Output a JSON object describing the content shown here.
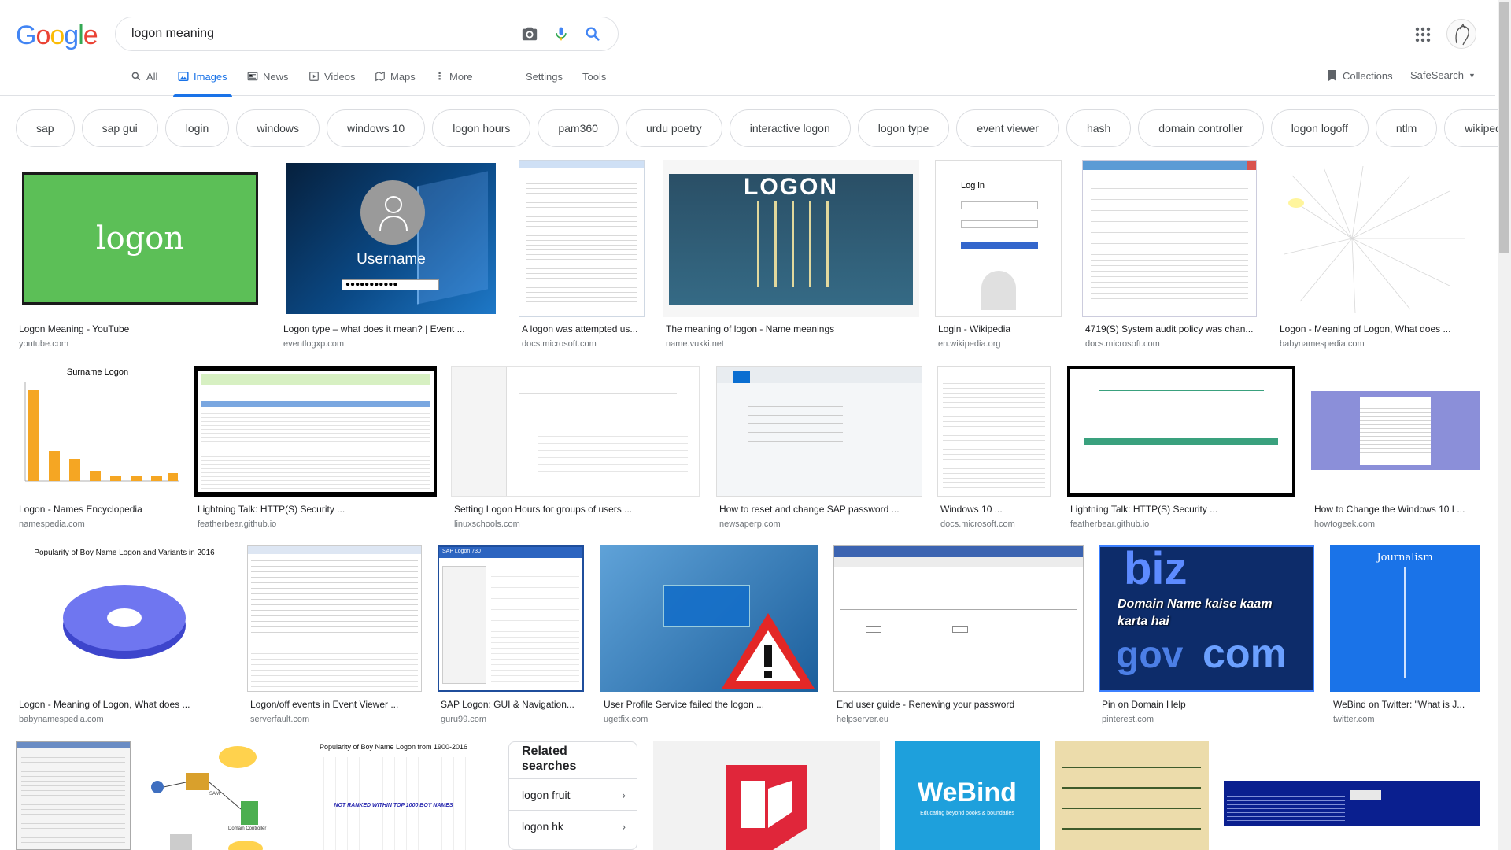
{
  "search": {
    "query": "logon meaning"
  },
  "logo": {
    "letters": [
      "G",
      "o",
      "o",
      "g",
      "l",
      "e"
    ],
    "colors": [
      "#4285F4",
      "#EA4335",
      "#FBBC05",
      "#4285F4",
      "#34A853",
      "#EA4335"
    ]
  },
  "tabs": [
    {
      "label": "All",
      "icon": "search-icon"
    },
    {
      "label": "Images",
      "icon": "image-icon",
      "active": true
    },
    {
      "label": "News",
      "icon": "news-icon"
    },
    {
      "label": "Videos",
      "icon": "video-icon"
    },
    {
      "label": "Maps",
      "icon": "map-icon"
    },
    {
      "label": "More",
      "icon": "more-vert-icon"
    }
  ],
  "tools": {
    "settings": "Settings",
    "tools": "Tools",
    "collections": "Collections",
    "safesearch": "SafeSearch"
  },
  "chips": [
    "sap",
    "sap gui",
    "login",
    "windows",
    "windows 10",
    "logon hours",
    "pam360",
    "urdu poetry",
    "interactive logon",
    "logon type",
    "event viewer",
    "hash",
    "domain controller",
    "logon logoff",
    "ntlm",
    "wikipedia"
  ],
  "results_row1": [
    {
      "caption": "Logon Meaning - YouTube",
      "source": "youtube.com",
      "overlay": "logon"
    },
    {
      "caption": "Logon type – what does it mean? | Event ...",
      "source": "eventlogxp.com",
      "overlay": "Username"
    },
    {
      "caption": "A logon was attempted us...",
      "source": "docs.microsoft.com"
    },
    {
      "caption": "The meaning of logon - Name meanings",
      "source": "name.vukki.net",
      "overlay": "LOGON"
    },
    {
      "caption": "Login - Wikipedia",
      "source": "en.wikipedia.org",
      "overlay": "Log in"
    },
    {
      "caption": "4719(S) System audit policy was chan...",
      "source": "docs.microsoft.com"
    },
    {
      "caption": "Logon - Meaning of Logon, What does ...",
      "source": "babynamespedia.com"
    }
  ],
  "results_row2": [
    {
      "caption": "Logon - Names Encyclopedia",
      "source": "namespedia.com",
      "overlay": "Surname Logon"
    },
    {
      "caption": "Lightning Talk: HTTP(S) Security ...",
      "source": "featherbear.github.io"
    },
    {
      "caption": "Setting Logon Hours for groups of users ...",
      "source": "linuxschools.com"
    },
    {
      "caption": "How to reset and change SAP password ...",
      "source": "newsaperp.com"
    },
    {
      "caption": "Windows 10 ...",
      "source": "docs.microsoft.com"
    },
    {
      "caption": "Lightning Talk: HTTP(S) Security ...",
      "source": "featherbear.github.io"
    },
    {
      "caption": "How to Change the Windows 10 L...",
      "source": "howtogeek.com"
    }
  ],
  "results_row3": [
    {
      "caption": "Logon - Meaning of Logon, What does ...",
      "source": "babynamespedia.com",
      "overlay": "Popularity of Boy Name Logon and Variants in 2016"
    },
    {
      "caption": "Logon/off events in Event Viewer ...",
      "source": "serverfault.com"
    },
    {
      "caption": "SAP Logon: GUI & Navigation...",
      "source": "guru99.com",
      "overlay": "SAP Logon 730"
    },
    {
      "caption": "User Profile Service failed the logon ...",
      "source": "ugetfix.com"
    },
    {
      "caption": "End user guide - Renewing your password",
      "source": "helpserver.eu"
    },
    {
      "caption": "Pin on Domain Help",
      "source": "pinterest.com",
      "overlay": "Domain Name kaise kaam karta hai"
    },
    {
      "caption": "WeBind on Twitter: \"What is J...",
      "source": "twitter.com",
      "overlay": "Journalism"
    }
  ],
  "row4_overlays": {
    "popularity": "Popularity of Boy Name Logon from 1900-2016",
    "not_ranked": "NOT RANKED WITHIN TOP 1000 BOY NAMES",
    "webind": "WeBind",
    "webind_tag": "Educating beyond books & boundaries",
    "domain_controller": "Domain Controller",
    "sam": "SAM"
  },
  "related": {
    "title": "Related searches",
    "items": [
      "logon fruit",
      "logon hk"
    ]
  }
}
